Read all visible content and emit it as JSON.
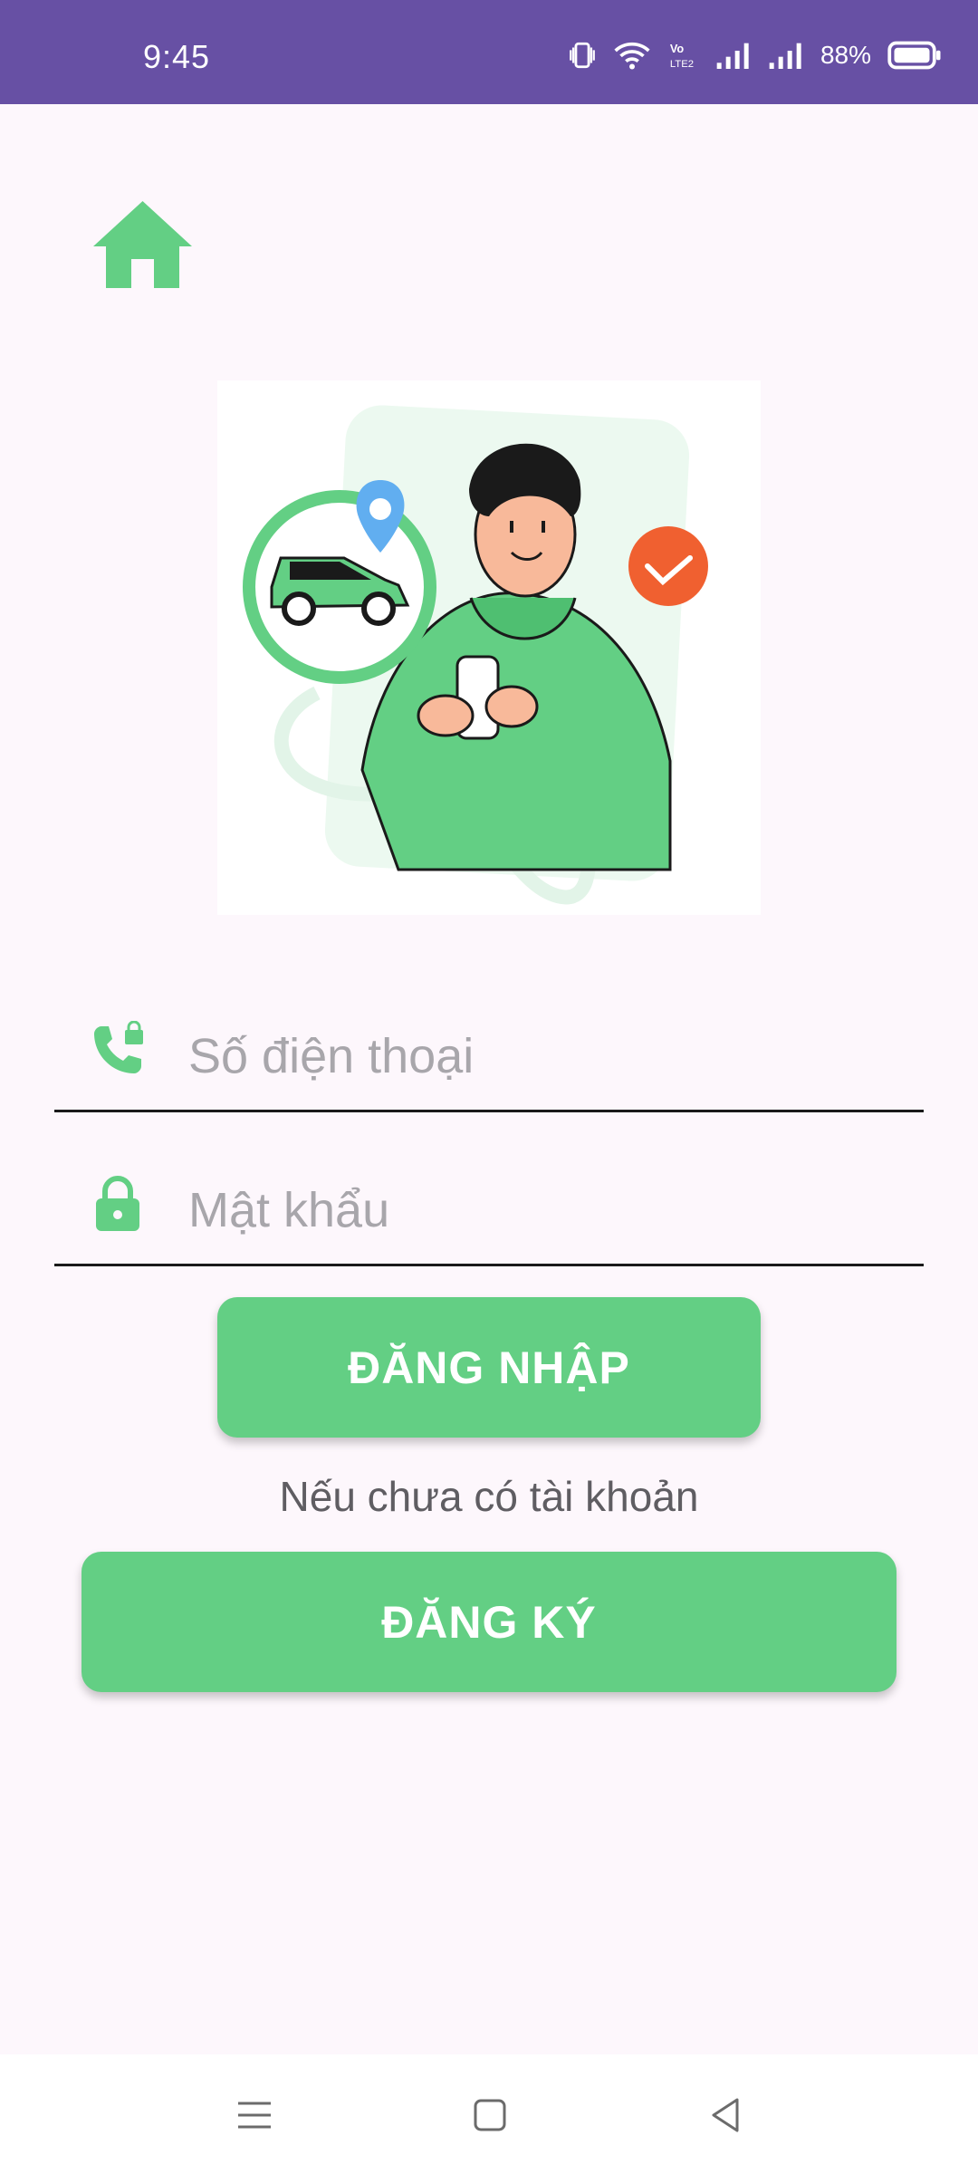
{
  "status_bar": {
    "time": "9:45",
    "battery": "88%",
    "icons": [
      "vibrate-icon",
      "wifi-icon",
      "volte-icon",
      "signal-icon",
      "signal-icon",
      "battery-icon"
    ]
  },
  "header": {
    "icon": "home-icon"
  },
  "illustration": {
    "description_icon": "person-phone-car-illustration"
  },
  "form": {
    "phone": {
      "placeholder": "Số điện thoại",
      "value": "",
      "icon": "phone-lock-icon"
    },
    "password": {
      "placeholder": "Mật khẩu",
      "value": "",
      "icon": "lock-icon"
    },
    "login_label": "ĐĂNG NHẬP",
    "hint": "Nếu chưa có tài khoản",
    "register_label": "ĐĂNG KÝ"
  },
  "nav_bar": {
    "items": [
      "menu-icon",
      "home-square-icon",
      "back-icon"
    ]
  },
  "colors": {
    "accent": "#63cf84",
    "status_bar": "#6750a4",
    "background": "#fdf7fc"
  }
}
